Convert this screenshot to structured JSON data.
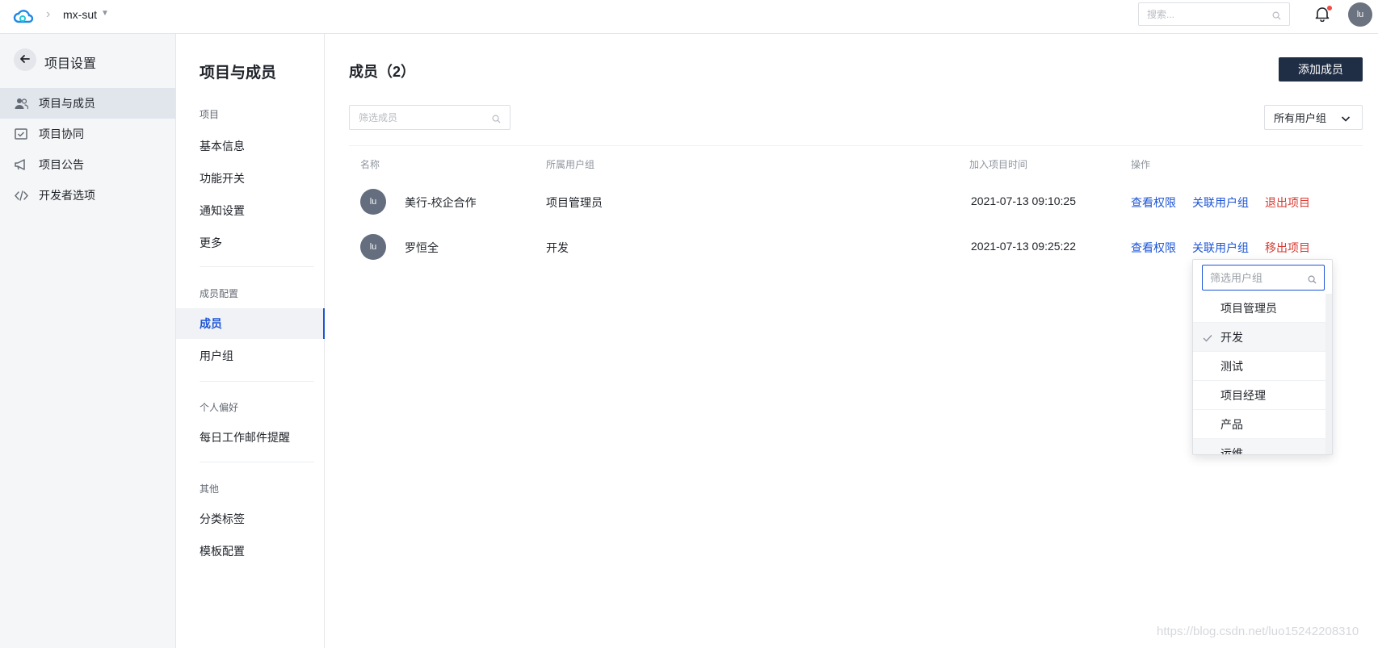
{
  "topbar": {
    "project_name": "mx-sut",
    "search_placeholder": "搜索...",
    "avatar_initials": "lu"
  },
  "sidebar": {
    "title": "项目设置",
    "items": [
      {
        "label": "项目与成员",
        "icon": "members-icon",
        "active": true
      },
      {
        "label": "项目协同",
        "icon": "collaboration-icon",
        "active": false
      },
      {
        "label": "项目公告",
        "icon": "announcement-icon",
        "active": false
      },
      {
        "label": "开发者选项",
        "icon": "code-icon",
        "active": false
      }
    ]
  },
  "subnav": {
    "title": "项目与成员",
    "groups": [
      {
        "label": "项目",
        "items": [
          "基本信息",
          "功能开关",
          "通知设置",
          "更多"
        ]
      },
      {
        "label": "成员配置",
        "items": [
          "成员",
          "用户组"
        ]
      },
      {
        "label": "个人偏好",
        "items": [
          "每日工作邮件提醒"
        ]
      },
      {
        "label": "其他",
        "items": [
          "分类标签",
          "模板配置"
        ]
      }
    ],
    "active_item": "成员"
  },
  "main": {
    "title": "成员（2）",
    "add_button": "添加成员",
    "filter_placeholder": "筛选成员",
    "group_filter": "所有用户组",
    "columns": [
      "名称",
      "所属用户组",
      "加入项目时间",
      "操作"
    ],
    "rows": [
      {
        "avatar": "lu",
        "name": "美行-校企合作",
        "group": "项目管理员",
        "joined": "2021-07-13 09:10:25",
        "actions": [
          "查看权限",
          "关联用户组",
          "退出项目"
        ]
      },
      {
        "avatar": "lu",
        "name": "罗恒全",
        "group": "开发",
        "joined": "2021-07-13 09:25:22",
        "actions": [
          "查看权限",
          "关联用户组",
          "移出项目"
        ]
      }
    ]
  },
  "dropdown": {
    "search_placeholder": "筛选用户组",
    "options": [
      {
        "label": "项目管理员",
        "checked": false
      },
      {
        "label": "开发",
        "checked": true
      },
      {
        "label": "测试",
        "checked": false
      },
      {
        "label": "项目经理",
        "checked": false
      },
      {
        "label": "产品",
        "checked": false
      },
      {
        "label": "运维",
        "checked": false
      }
    ]
  },
  "watermark": "https://blog.csdn.net/luo15242208310",
  "colors": {
    "accent": "#1d55d6",
    "danger": "#d83931",
    "primary_button": "#1f2d45"
  }
}
